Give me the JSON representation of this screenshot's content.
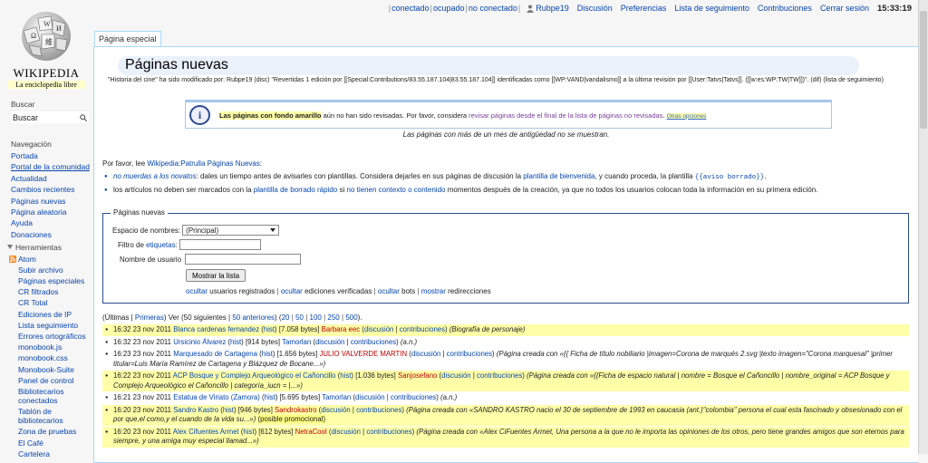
{
  "personal": {
    "status": [
      "conectado",
      "ocupado",
      "no conectado"
    ],
    "user": "Rubpe19",
    "links": [
      "Discusión",
      "Preferencias",
      "Lista de seguimiento",
      "Contribuciones",
      "Cerrar sesión"
    ],
    "time": "15:33:19"
  },
  "logo": {
    "wordmark": "WIKIPEDIA",
    "tagline": "La enciclopedia libre"
  },
  "sidebar": {
    "search_heading": "Buscar",
    "search_value": "Buscar",
    "nav_heading": "Navegación",
    "nav": [
      "Portada",
      "Portal de la comunidad",
      "Actualidad",
      "Cambios recientes",
      "Páginas nuevas",
      "Página aleatoria",
      "Ayuda",
      "Donaciones"
    ],
    "tools_heading": "Herramientas",
    "tools": [
      "Atom",
      "Subir archivo",
      "Páginas especiales",
      "CR filtrados",
      "CR Total",
      "Ediciones de IP",
      "Lista seguimiento",
      "Errores ortográficos",
      "monobook.js",
      "monobook.css",
      "Monobook-Suite",
      "Panel de control",
      "Bibliotecarios conectados",
      "Tablón de bibliotecarios",
      "Zona de pruebas",
      "El Café",
      "Cartelera"
    ]
  },
  "tab": "Página especial",
  "page": {
    "title": "Páginas nuevas",
    "history_note": "\"Historia del cine\" ha sido modificado por: Rubpe19 (disc) \"Revertidas 1 edición por [[Special:Contributions/83.55.187.104|83.55.187.104]] identificadas como [[WP:VAND|vandalismo]] a la última revisión por [[User:Tatvs|Tatvs]]. ([[w:es:WP:TW|TW]])\". (dif) (lista de seguimiento)"
  },
  "notice": {
    "part1": "Las páginas con fondo amarillo",
    "part2": " aún no han sido revisadas. Por favor, considera ",
    "link": "revisar páginas desde el final de la lista de páginas no revisadas",
    "part3": ". ",
    "opts": "Otras opciones",
    "sub": "Las páginas con más de un mes de antigüedad no se muestran."
  },
  "intro": {
    "text": "Por favor, lee ",
    "link": "Wikipedia:Patrulla Páginas Nuevas",
    "end": ":"
  },
  "bullets": {
    "b1_link1": "no muerdas a los novatos",
    "b1_text1": ": dales un tiempo antes de avisarles con plantillas. Considera dejarles en sus páginas de discusión la ",
    "b1_link2": "plantilla de bienvenida",
    "b1_text2": ", y cuando proceda, la plantilla ",
    "b1_code": "{{aviso borrado}}",
    "b1_text3": ".",
    "b2_text1": "los artículos no deben ser marcados con la ",
    "b2_link1": "plantilla de borrado rápido",
    "b2_text2": " si ",
    "b2_link2": "no tienen contexto o contenido",
    "b2_text3": " momentos después de la creación, ya que no todos los usuarios colocan toda la información en su primera edición."
  },
  "form": {
    "legend": "Páginas nuevas",
    "ns_label": "Espacio de nombres:",
    "ns_value": "(Principal)",
    "tag_label_a": "Filtro de ",
    "tag_label_link": "etiquetas",
    "tag_label_b": ":",
    "user_label": "Nombre de usuario",
    "submit": "Mostrar la lista",
    "opt_hide1": "ocultar",
    "opt_text1": " usuarios registrados",
    "opt_hide2": "ocultar",
    "opt_text2": " ediciones verificadas",
    "opt_hide3": "ocultar",
    "opt_text3": " bots",
    "opt_show": "mostrar",
    "opt_text4": " redirecciones"
  },
  "pager": {
    "prefix": "(Últimas | ",
    "first": "Primeras",
    "mid": ") Ver (50 siguientes | ",
    "prev": "50 anteriores",
    "mid2": ") (",
    "sizes": [
      "20",
      "50",
      "100",
      "250",
      "500"
    ],
    "end": ")."
  },
  "entries": [
    {
      "time": "16:32 23 nov 2011",
      "title": "Blanca cardenas fernandez",
      "bytes": "[7.058 bytes]",
      "user": "Barbara eec",
      "user_red": true,
      "summary": "(Biografía de personaje)",
      "unp": true
    },
    {
      "time": "16:32 23 nov 2011",
      "title": "Ursicinio Álvarez",
      "bytes": "[914 bytes]",
      "user": "Tamorlan",
      "user_red": false,
      "summary": "(a.n.)",
      "unp": false
    },
    {
      "time": "16:23 23 nov 2011",
      "title": "Marquesado de Cartagena",
      "bytes": "[1.656 bytes]",
      "user": "JULIO VALVERDE MARTIN",
      "user_red": true,
      "summary": "(Página creada con «{{ Ficha de título nobiliario |imagen=Corona de marqués 2.svg |texto imagen=\"Corona marquesal\" |primer titular=Luis María Ramírez de Cartagena y Blázquez de Bocane...»)",
      "unp": false
    },
    {
      "time": "16:22 23 nov 2011",
      "title": "ACP Bosque y Complejo Arqueológico el Cañoncillo",
      "bytes": "[1.036 bytes]",
      "user": "Sanjosefano",
      "user_red": true,
      "summary": "(Página creada con «{{Ficha de espacio natural | nombre = Bosque el Cañoncillo | nombre_original = ACP Bosque y Complejo Arqueológico el Cañoncillo | categoría_iucn = |...»)",
      "unp": true
    },
    {
      "time": "16:21 23 nov 2011",
      "title": "Estatua de Viriato (Zamora)",
      "bytes": "[5.695 bytes]",
      "user": "Tamorlan",
      "user_red": false,
      "summary": "(a.n.)",
      "unp": false
    },
    {
      "time": "16:20 23 nov 2011",
      "title": "Sandro Kastro",
      "bytes": "[946 bytes]",
      "user": "Sandrokastro",
      "user_red": true,
      "summary": "(Página creada con «SANDRO KASTRO nacio el 30 de septiembre de 1993 en caucasia (ant.)\"colombia\" persona el cual esta fascinado y obsesionado con el por que,el como,y el cuando de la vida su...»)",
      "tag": "(posible promocional)",
      "unp": true
    },
    {
      "time": "16:20 23 nov 2011",
      "title": "Alex Cifuentes Armet",
      "bytes": "[612 bytes]",
      "user": "NetraCool",
      "user_red": true,
      "summary": "(Página creada con «Alex CiFuentes Armet, Una persona a la que no le importa las opiniones de los otros, pero tiene grandes amigos que son eternos para siempre, y una amiga muy especial llamad...»)",
      "unp": true
    }
  ],
  "labels": {
    "hist": "hist",
    "disc": "discusión",
    "contribs": "contribuciones"
  }
}
